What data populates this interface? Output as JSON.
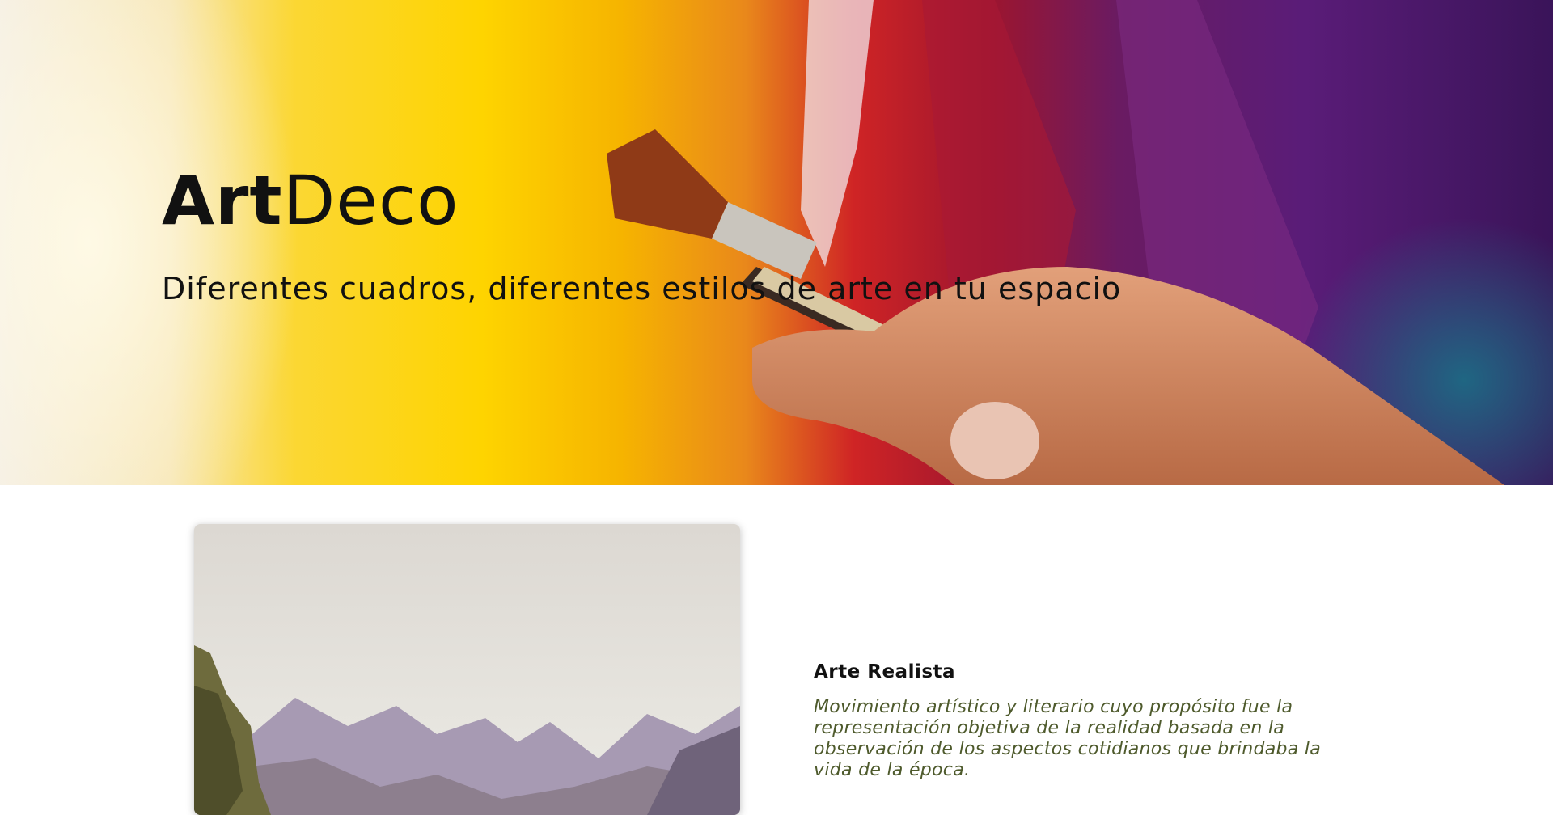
{
  "hero": {
    "brand_bold": "Art",
    "brand_regular": "Deco",
    "tagline": "Diferentes cuadros, diferentes estilos de arte en tu espacio"
  },
  "featured": {
    "title": "Arte Realista",
    "description": "Movimiento artístico y literario cuyo propósito fue la representación objetiva de la realidad basada en la observación de los aspectos cotidianos que brindaba la vida de la época."
  },
  "colors": {
    "description_text": "#4e5a2c",
    "heading_text": "#111111"
  }
}
